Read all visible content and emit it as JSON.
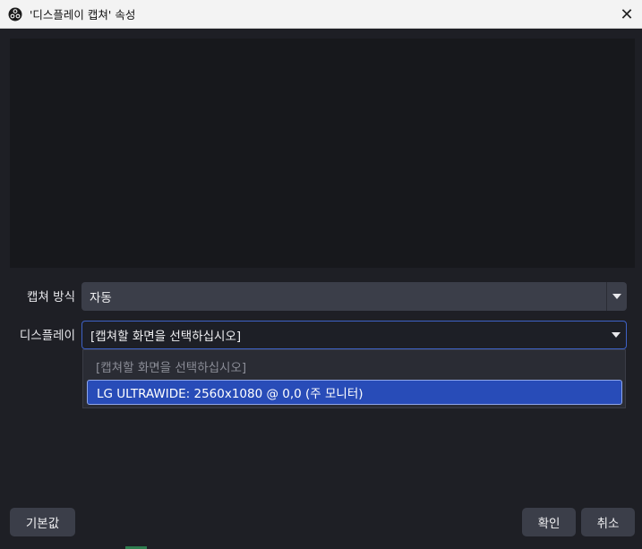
{
  "window": {
    "title": "'디스플레이 캡쳐' 속성",
    "close_glyph": "✕"
  },
  "form": {
    "capture_method": {
      "label": "캡쳐 방식",
      "value": "자동"
    },
    "display": {
      "label": "디스플레이",
      "value": "[캡쳐할 화면을 선택하십시오]"
    }
  },
  "display_dropdown": {
    "items": [
      {
        "label": "[캡쳐할 화면을 선택하십시오]",
        "disabled": true
      },
      {
        "label": "LG ULTRAWIDE: 2560x1080 @ 0,0 (주 모니터)",
        "selected": true
      }
    ]
  },
  "buttons": {
    "defaults": "기본값",
    "ok": "확인",
    "cancel": "취소"
  },
  "colors": {
    "background": "#1e1f25",
    "accent": "#284cb8",
    "control": "#3b3e49"
  }
}
